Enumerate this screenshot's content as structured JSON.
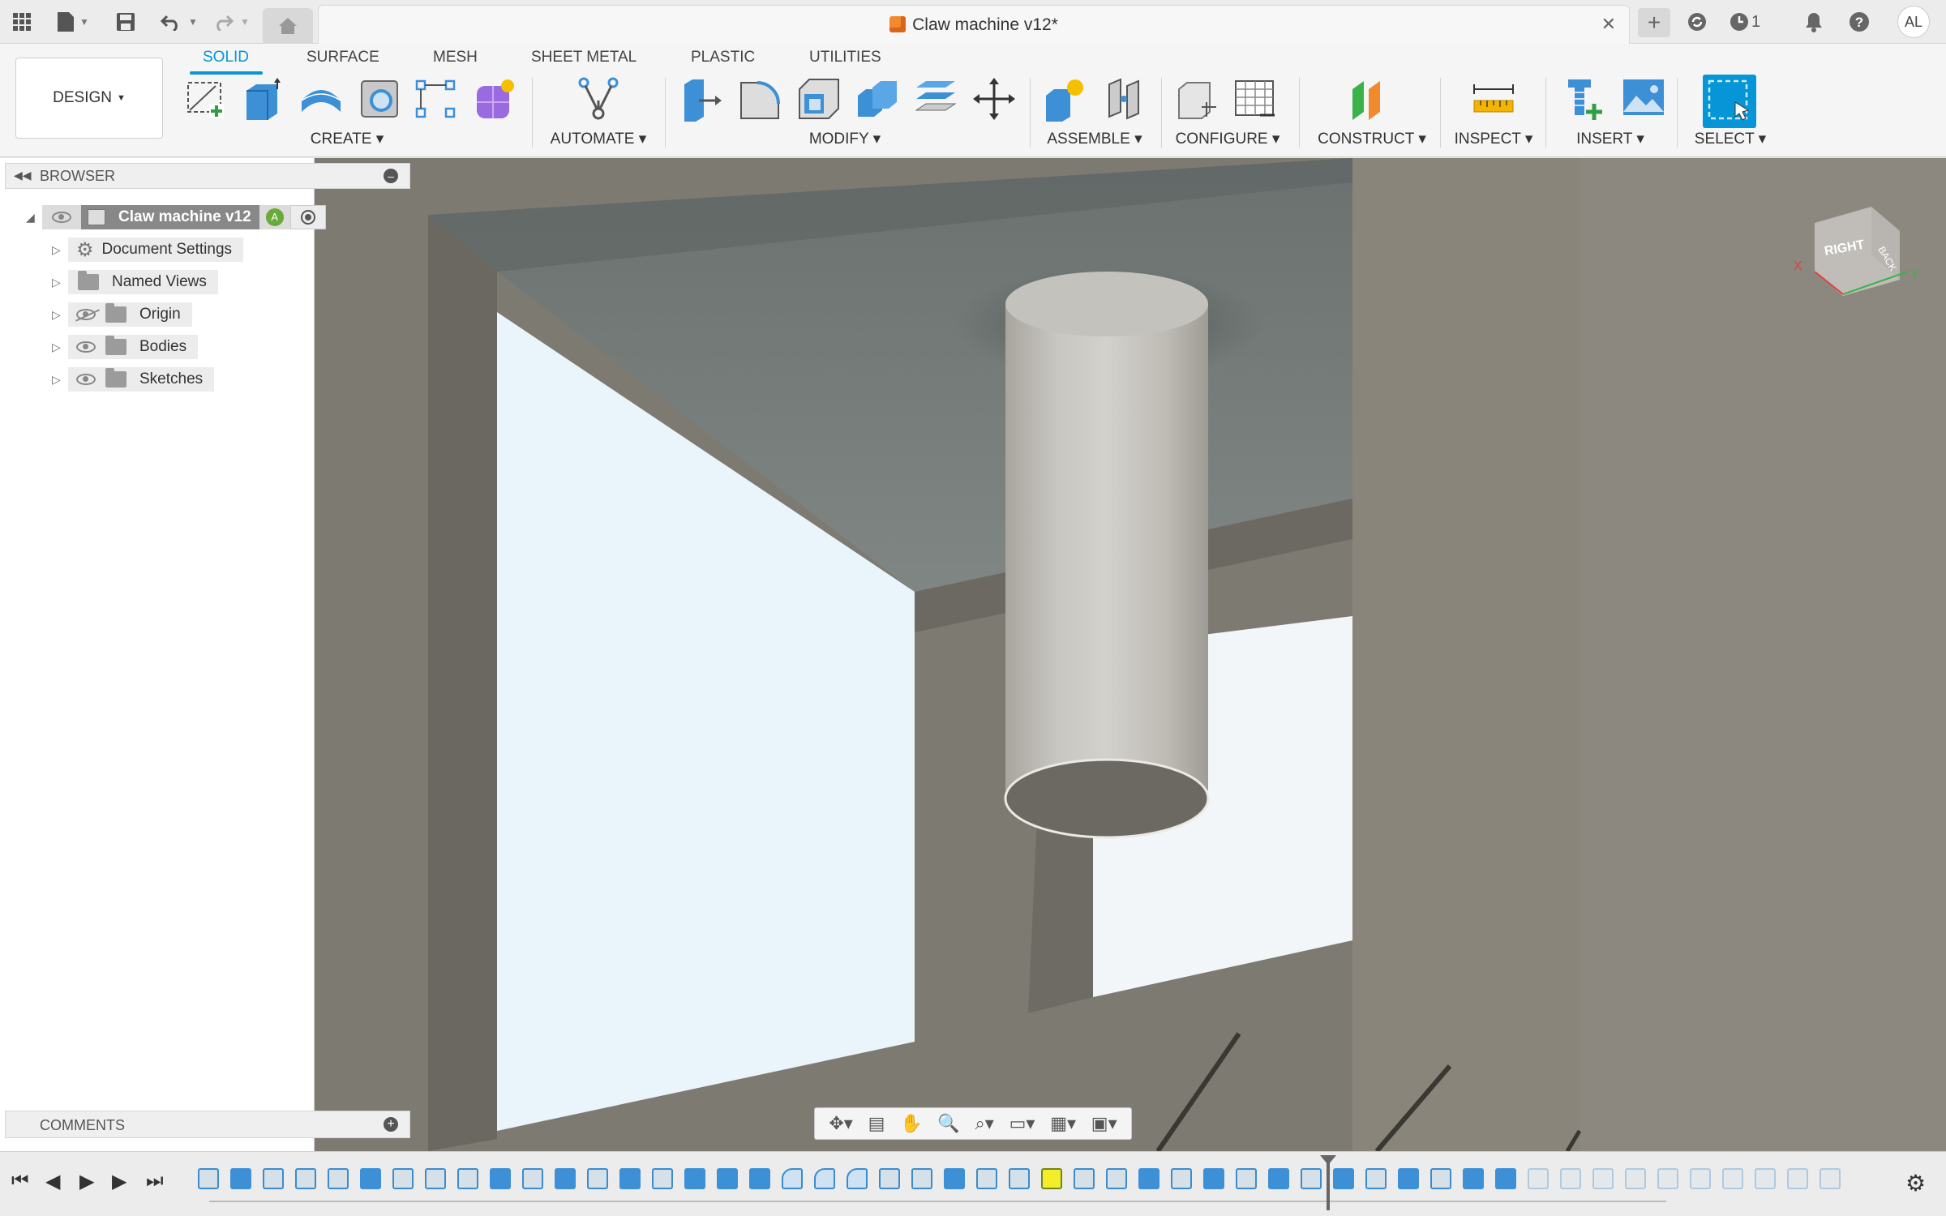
{
  "titlebar": {
    "document_title": "Claw machine v12*",
    "jobs_count": "1",
    "user_initials": "AL"
  },
  "workspace": {
    "label": "DESIGN"
  },
  "tabs": [
    {
      "label": "SOLID",
      "active": true
    },
    {
      "label": "SURFACE",
      "active": false
    },
    {
      "label": "MESH",
      "active": false
    },
    {
      "label": "SHEET METAL",
      "active": false
    },
    {
      "label": "PLASTIC",
      "active": false
    },
    {
      "label": "UTILITIES",
      "active": false
    }
  ],
  "groups": {
    "create": "CREATE",
    "automate": "AUTOMATE",
    "modify": "MODIFY",
    "assemble": "ASSEMBLE",
    "configure": "CONFIGURE",
    "construct": "CONSTRUCT",
    "inspect": "INSPECT",
    "insert": "INSERT",
    "select": "SELECT"
  },
  "browser": {
    "title": "BROWSER",
    "root": "Claw machine v12",
    "items": [
      {
        "label": "Document Settings",
        "icon": "gear-icon",
        "eye": "none"
      },
      {
        "label": "Named Views",
        "icon": "folder-icon",
        "eye": "none"
      },
      {
        "label": "Origin",
        "icon": "folder-icon",
        "eye": "hidden"
      },
      {
        "label": "Bodies",
        "icon": "folder-icon",
        "eye": "visible"
      },
      {
        "label": "Sketches",
        "icon": "folder-icon",
        "eye": "visible"
      }
    ]
  },
  "comments": {
    "title": "COMMENTS"
  },
  "viewcube": {
    "front_face": "RIGHT",
    "side_face": "BACK",
    "axis_x": "X",
    "axis_y": "Y"
  },
  "colors": {
    "accent": "#0696d7",
    "viewport_bg": "#7d7a72"
  }
}
